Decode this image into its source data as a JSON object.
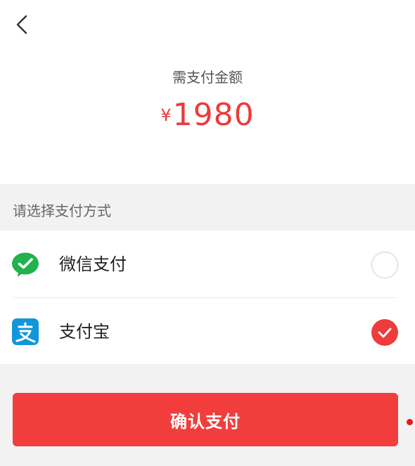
{
  "header": {
    "back_icon": "chevron-left-icon"
  },
  "amount": {
    "label": "需支付金额",
    "currency": "¥",
    "value": "1980",
    "color": "#ee3a3a"
  },
  "payment": {
    "section_title": "请选择支付方式",
    "methods": [
      {
        "label": "微信支付",
        "icon": "wechat-pay-icon",
        "selected": false
      },
      {
        "label": "支付宝",
        "icon": "alipay-icon",
        "selected": true
      }
    ]
  },
  "confirm": {
    "label": "确认支付",
    "color": "#f23d3d"
  }
}
